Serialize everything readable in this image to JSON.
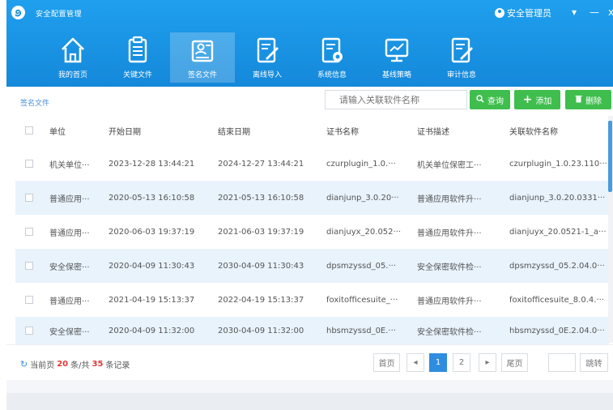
{
  "app": {
    "title": "安全配置管理",
    "user": "安全管理员",
    "menu_symbol": "▾",
    "minimize_symbol": "—",
    "close_symbol": "x"
  },
  "nav": [
    {
      "label": "我的首页",
      "icon": "home-icon"
    },
    {
      "label": "关键文件",
      "icon": "document-icon"
    },
    {
      "label": "签名文件",
      "icon": "signature-file-icon",
      "active": true
    },
    {
      "label": "离线导入",
      "icon": "edit-import-icon"
    },
    {
      "label": "系统信息",
      "icon": "system-info-icon"
    },
    {
      "label": "基线策略",
      "icon": "monitor-chart-icon"
    },
    {
      "label": "审计信息",
      "icon": "audit-icon"
    }
  ],
  "breadcrumb": "签名文件",
  "search": {
    "placeholder": "请输入关联软件名称"
  },
  "buttons": {
    "search": "查询",
    "add": "添加",
    "delete": "删除"
  },
  "table": {
    "headers": [
      "单位",
      "开始日期",
      "结束日期",
      "证书名称",
      "证书描述",
      "关联软件名称"
    ],
    "rows": [
      [
        "机关单位···",
        "2023-12-28 13:44:21",
        "2024-12-27 13:44:21",
        "czurplugin_1.0.···",
        "机关单位保密工···",
        "czurplugin_1.0.23.110···"
      ],
      [
        "普通应用···",
        "2020-05-13 16:10:58",
        "2021-05-13 16:10:58",
        "dianjunp_3.0.20···",
        "普通应用软件升···",
        "dianjunp_3.0.20.0331···"
      ],
      [
        "普通应用···",
        "2020-06-03 19:37:19",
        "2021-06-03 19:37:19",
        "dianjuyx_20.052···",
        "普通应用软件升···",
        "dianjuyx_20.0521-1_a···"
      ],
      [
        "安全保密···",
        "2020-04-09 11:30:43",
        "2030-04-09 11:30:43",
        "dpsmzyssd_05.···",
        "安全保密软件检···",
        "dpsmzyssd_05.2.04.0···"
      ],
      [
        "普通应用···",
        "2021-04-19 15:13:37",
        "2022-04-19 15:13:37",
        "foxitofficesuite_···",
        "普通应用软件升···",
        "foxitofficesuite_8.0.4.···"
      ],
      [
        "安全保密···",
        "2020-04-09 11:32:00",
        "2030-04-09 11:32:00",
        "hbsmzyssd_0E.···",
        "安全保密软件检···",
        "hbsmzyssd_0E.2.04.0···"
      ]
    ]
  },
  "pagination": {
    "prefix": "当前页",
    "current_page_size": "20",
    "mid": "条/共",
    "total": "35",
    "suffix": "条记录",
    "first": "首页",
    "prev": "◂",
    "pages": [
      "1",
      "2"
    ],
    "next": "▸",
    "last": "尾页",
    "jump": "跳转"
  },
  "colors": {
    "accent": "#1588da",
    "button_green": "#3fbe4e",
    "row_alt": "#e8f3fc",
    "red": "#e03a3a"
  }
}
